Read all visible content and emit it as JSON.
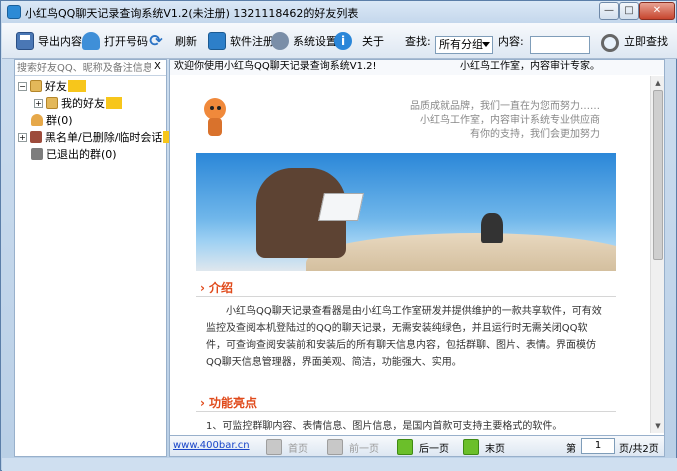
{
  "window": {
    "title": "小红鸟QQ聊天记录查询系统V1.2(未注册) 1321118462的好友列表",
    "min_label": "—",
    "max_label": "□",
    "close_label": "✕"
  },
  "toolbar": {
    "export_label": "导出内容",
    "open_label": "打开号码",
    "refresh_label": "刷新",
    "register_label": "软件注册",
    "settings_label": "系统设置",
    "about_label": "关于",
    "find_label": "查找:",
    "group_select": "所有分组",
    "content_label": "内容:",
    "content_value": "",
    "search_now_label": "立即查找"
  },
  "left": {
    "search_placeholder": "搜索好友QQ、昵称及备注信息",
    "clear_label": "X",
    "tree": [
      {
        "label": "好友"
      },
      {
        "label": "我的好友"
      },
      {
        "label": "群(0)"
      },
      {
        "label": "黑名单/已删除/临时会话"
      },
      {
        "label": "已退出的群(0)"
      }
    ]
  },
  "right": {
    "welcome": "欢迎你使用小红鸟QQ聊天记录查询系统V1.2!",
    "studio": "小红鸟工作室，内容审计专家。",
    "slogan_1": "品质成就品牌，我们一直在为您而努力……",
    "slogan_2": "小红鸟工作室，内容审计系统专业供应商",
    "slogan_3": "有你的支持，我们会更加努力",
    "section1_title": "介绍",
    "section1_body": "小红鸟QQ聊天记录查看器是由小红鸟工作室研发并提供维护的一款共享软件，可有效监控及查阅本机登陆过的QQ的聊天记录，无需安装纯绿色，并且运行时无需关闭QQ软件，可查询查阅安装前和安装后的所有聊天信息内容，包括群聊、图片、表情。界面模仿QQ聊天信息管理器，界面美观、简洁，功能强大、实用。",
    "section2_title": "功能亮点",
    "section2_body": "1、可监控群聊内容、表情信息、图片信息，是国内首款可支持主要格式的软件。"
  },
  "footer": {
    "link": "www.400bar.cn",
    "first_page": "首页",
    "prev_page": "前一页",
    "next_page": "后一页",
    "last_page": "末页",
    "page_prefix": "第",
    "current_page": "1",
    "page_suffix": "页/共2页"
  }
}
